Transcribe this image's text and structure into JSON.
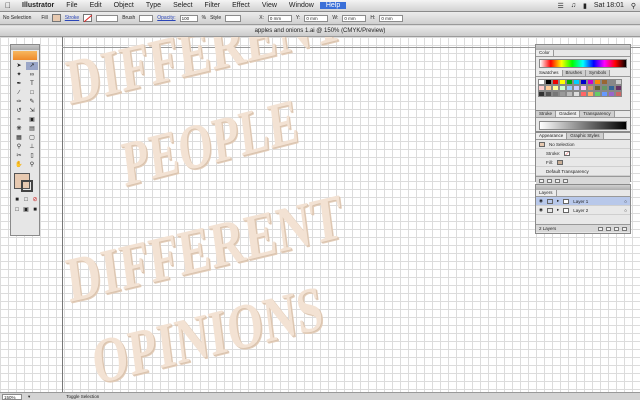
{
  "menubar": {
    "app": "Illustrator",
    "items": [
      "File",
      "Edit",
      "Object",
      "Type",
      "Select",
      "Filter",
      "Effect",
      "View",
      "Window",
      "Help"
    ],
    "active": "Help",
    "clock": "Sat 18:01"
  },
  "control": {
    "selection": "No Selection",
    "fill_label": "Fill",
    "stroke_label": "Stroke",
    "brush_label": "Brush",
    "opacity_label": "Opacity:",
    "opacity_value": "100",
    "percent": "%",
    "style_label": "Style",
    "x_label": "X:",
    "x_value": "0 mm",
    "y_label": "Y:",
    "y_value": "0 mm",
    "w_label": "W:",
    "w_value": "0 mm",
    "h_label": "H:",
    "h_value": "0 mm"
  },
  "document": {
    "title": "apples and onions 1.ai @ 150% (CMYK/Preview)"
  },
  "artwork": {
    "line1": "DIFFERENT",
    "line2": "PEOPLE",
    "line3": "DIFFERENT",
    "line4": "OPINIONS"
  },
  "status": {
    "zoom": "150%",
    "info": "Toggle Selection"
  },
  "panels": {
    "color_title": "Color",
    "swatch_tabs": [
      "Swatches",
      "Brushes",
      "Symbols"
    ],
    "stroke_tabs": [
      "Stroke",
      "Gradient",
      "Transparency"
    ],
    "appearance_tabs": [
      "Appearance",
      "Graphic Styles"
    ],
    "appearance_header": "No Selection",
    "appearance_rows": [
      "Stroke:",
      "Fill:",
      "Default Transparency"
    ],
    "layers_title": "Layers",
    "layers": [
      "Layer 1",
      "Layer 2"
    ],
    "layers_count": "2 Layers"
  },
  "colors": {
    "artwork_fill": "#f3e2d3",
    "selection_blue": "#b8c8ea"
  }
}
